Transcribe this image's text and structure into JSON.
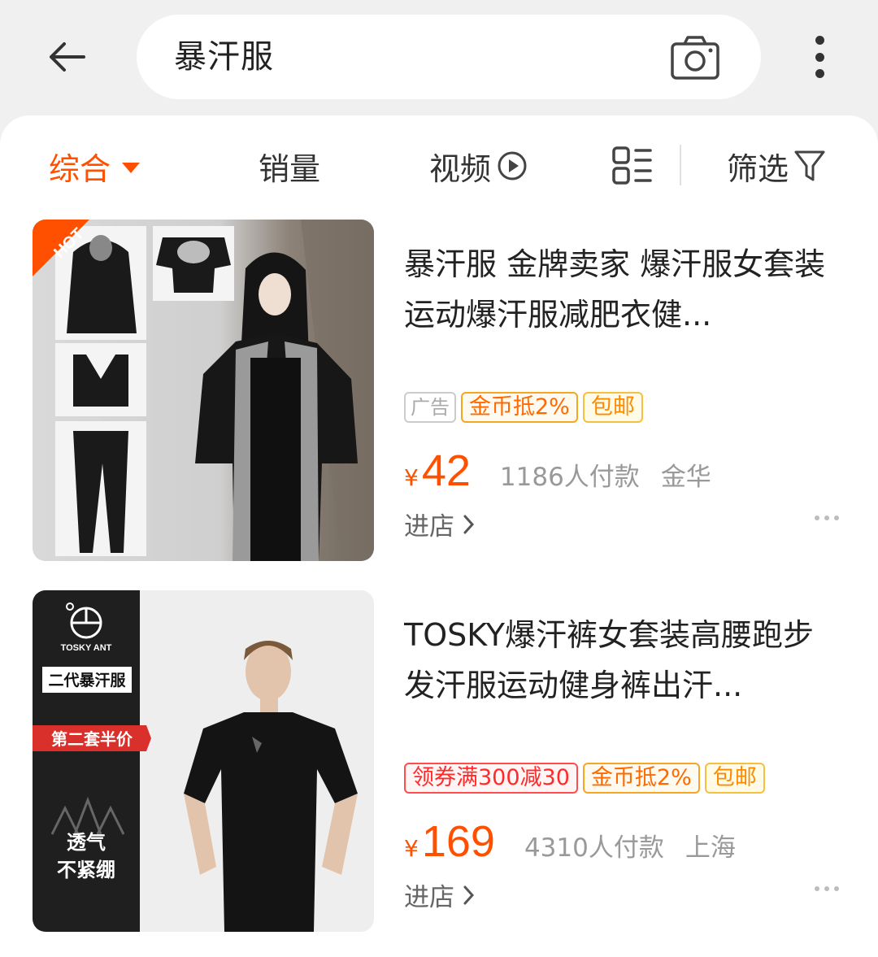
{
  "search": {
    "query": "暴汗服",
    "back_icon": "arrow-left-icon",
    "camera_icon": "camera-icon",
    "more_icon": "more-vertical-icon"
  },
  "sort_bar": {
    "items": [
      {
        "label": "综合",
        "active": true
      },
      {
        "label": "销量"
      },
      {
        "label": "视频"
      },
      {
        "label": "筛选"
      }
    ],
    "layout_icon": "list-layout-icon",
    "video_icon": "play-circle-icon",
    "filter_icon": "funnel-icon"
  },
  "products": [
    {
      "title": "暴汗服 金牌卖家 爆汗服女套装运动爆汗服减肥衣健...",
      "tags": [
        "广告",
        "金币抵2%",
        "包邮"
      ],
      "currency": "¥",
      "price": "42",
      "sales": "1186人付款",
      "location": "金华",
      "shop_link": "进店",
      "badge": "HOT"
    },
    {
      "title": "TOSKY爆汗裤女套装高腰跑步发汗服运动健身裤出汗...",
      "tags": [
        "领券满300减30",
        "金币抵2%",
        "包邮"
      ],
      "currency": "¥",
      "price": "169",
      "sales": "4310人付款",
      "location": "上海",
      "shop_link": "进店",
      "brand": "TOSKY ANT",
      "promo_1": "二代暴汗服",
      "promo_2": "第二套半价",
      "promo_3_line1": "透气",
      "promo_3_line2": "不紧绷"
    }
  ],
  "colors": {
    "accent": "#ff5000",
    "background": "#f0f0f0"
  }
}
